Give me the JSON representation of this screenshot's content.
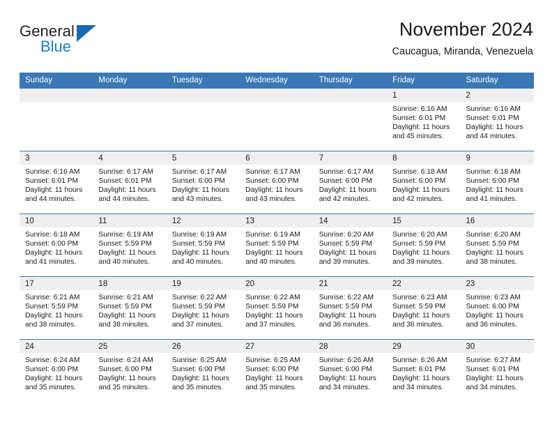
{
  "brand": {
    "name_part1": "General",
    "name_part2": "Blue",
    "accent_color": "#1d7fc3",
    "triangle_color": "#1868b0"
  },
  "header": {
    "title": "November 2024",
    "subtitle": "Caucagua, Miranda, Venezuela"
  },
  "calendar": {
    "header_bg": "#3a78b5",
    "cell_head_bg": "#efefef",
    "weekday_headers": [
      "Sunday",
      "Monday",
      "Tuesday",
      "Wednesday",
      "Thursday",
      "Friday",
      "Saturday"
    ],
    "weeks": [
      [
        {
          "day": "",
          "lines": []
        },
        {
          "day": "",
          "lines": []
        },
        {
          "day": "",
          "lines": []
        },
        {
          "day": "",
          "lines": []
        },
        {
          "day": "",
          "lines": []
        },
        {
          "day": "1",
          "lines": [
            "Sunrise: 6:16 AM",
            "Sunset: 6:01 PM",
            "Daylight: 11 hours",
            "and 45 minutes."
          ]
        },
        {
          "day": "2",
          "lines": [
            "Sunrise: 6:16 AM",
            "Sunset: 6:01 PM",
            "Daylight: 11 hours",
            "and 44 minutes."
          ]
        }
      ],
      [
        {
          "day": "3",
          "lines": [
            "Sunrise: 6:16 AM",
            "Sunset: 6:01 PM",
            "Daylight: 11 hours",
            "and 44 minutes."
          ]
        },
        {
          "day": "4",
          "lines": [
            "Sunrise: 6:17 AM",
            "Sunset: 6:01 PM",
            "Daylight: 11 hours",
            "and 44 minutes."
          ]
        },
        {
          "day": "5",
          "lines": [
            "Sunrise: 6:17 AM",
            "Sunset: 6:00 PM",
            "Daylight: 11 hours",
            "and 43 minutes."
          ]
        },
        {
          "day": "6",
          "lines": [
            "Sunrise: 6:17 AM",
            "Sunset: 6:00 PM",
            "Daylight: 11 hours",
            "and 43 minutes."
          ]
        },
        {
          "day": "7",
          "lines": [
            "Sunrise: 6:17 AM",
            "Sunset: 6:00 PM",
            "Daylight: 11 hours",
            "and 42 minutes."
          ]
        },
        {
          "day": "8",
          "lines": [
            "Sunrise: 6:18 AM",
            "Sunset: 6:00 PM",
            "Daylight: 11 hours",
            "and 42 minutes."
          ]
        },
        {
          "day": "9",
          "lines": [
            "Sunrise: 6:18 AM",
            "Sunset: 6:00 PM",
            "Daylight: 11 hours",
            "and 41 minutes."
          ]
        }
      ],
      [
        {
          "day": "10",
          "lines": [
            "Sunrise: 6:18 AM",
            "Sunset: 6:00 PM",
            "Daylight: 11 hours",
            "and 41 minutes."
          ]
        },
        {
          "day": "11",
          "lines": [
            "Sunrise: 6:19 AM",
            "Sunset: 5:59 PM",
            "Daylight: 11 hours",
            "and 40 minutes."
          ]
        },
        {
          "day": "12",
          "lines": [
            "Sunrise: 6:19 AM",
            "Sunset: 5:59 PM",
            "Daylight: 11 hours",
            "and 40 minutes."
          ]
        },
        {
          "day": "13",
          "lines": [
            "Sunrise: 6:19 AM",
            "Sunset: 5:59 PM",
            "Daylight: 11 hours",
            "and 40 minutes."
          ]
        },
        {
          "day": "14",
          "lines": [
            "Sunrise: 6:20 AM",
            "Sunset: 5:59 PM",
            "Daylight: 11 hours",
            "and 39 minutes."
          ]
        },
        {
          "day": "15",
          "lines": [
            "Sunrise: 6:20 AM",
            "Sunset: 5:59 PM",
            "Daylight: 11 hours",
            "and 39 minutes."
          ]
        },
        {
          "day": "16",
          "lines": [
            "Sunrise: 6:20 AM",
            "Sunset: 5:59 PM",
            "Daylight: 11 hours",
            "and 38 minutes."
          ]
        }
      ],
      [
        {
          "day": "17",
          "lines": [
            "Sunrise: 6:21 AM",
            "Sunset: 5:59 PM",
            "Daylight: 11 hours",
            "and 38 minutes."
          ]
        },
        {
          "day": "18",
          "lines": [
            "Sunrise: 6:21 AM",
            "Sunset: 5:59 PM",
            "Daylight: 11 hours",
            "and 38 minutes."
          ]
        },
        {
          "day": "19",
          "lines": [
            "Sunrise: 6:22 AM",
            "Sunset: 5:59 PM",
            "Daylight: 11 hours",
            "and 37 minutes."
          ]
        },
        {
          "day": "20",
          "lines": [
            "Sunrise: 6:22 AM",
            "Sunset: 5:59 PM",
            "Daylight: 11 hours",
            "and 37 minutes."
          ]
        },
        {
          "day": "21",
          "lines": [
            "Sunrise: 6:22 AM",
            "Sunset: 5:59 PM",
            "Daylight: 11 hours",
            "and 36 minutes."
          ]
        },
        {
          "day": "22",
          "lines": [
            "Sunrise: 6:23 AM",
            "Sunset: 5:59 PM",
            "Daylight: 11 hours",
            "and 36 minutes."
          ]
        },
        {
          "day": "23",
          "lines": [
            "Sunrise: 6:23 AM",
            "Sunset: 6:00 PM",
            "Daylight: 11 hours",
            "and 36 minutes."
          ]
        }
      ],
      [
        {
          "day": "24",
          "lines": [
            "Sunrise: 6:24 AM",
            "Sunset: 6:00 PM",
            "Daylight: 11 hours",
            "and 35 minutes."
          ]
        },
        {
          "day": "25",
          "lines": [
            "Sunrise: 6:24 AM",
            "Sunset: 6:00 PM",
            "Daylight: 11 hours",
            "and 35 minutes."
          ]
        },
        {
          "day": "26",
          "lines": [
            "Sunrise: 6:25 AM",
            "Sunset: 6:00 PM",
            "Daylight: 11 hours",
            "and 35 minutes."
          ]
        },
        {
          "day": "27",
          "lines": [
            "Sunrise: 6:25 AM",
            "Sunset: 6:00 PM",
            "Daylight: 11 hours",
            "and 35 minutes."
          ]
        },
        {
          "day": "28",
          "lines": [
            "Sunrise: 6:26 AM",
            "Sunset: 6:00 PM",
            "Daylight: 11 hours",
            "and 34 minutes."
          ]
        },
        {
          "day": "29",
          "lines": [
            "Sunrise: 6:26 AM",
            "Sunset: 6:01 PM",
            "Daylight: 11 hours",
            "and 34 minutes."
          ]
        },
        {
          "day": "30",
          "lines": [
            "Sunrise: 6:27 AM",
            "Sunset: 6:01 PM",
            "Daylight: 11 hours",
            "and 34 minutes."
          ]
        }
      ]
    ]
  }
}
